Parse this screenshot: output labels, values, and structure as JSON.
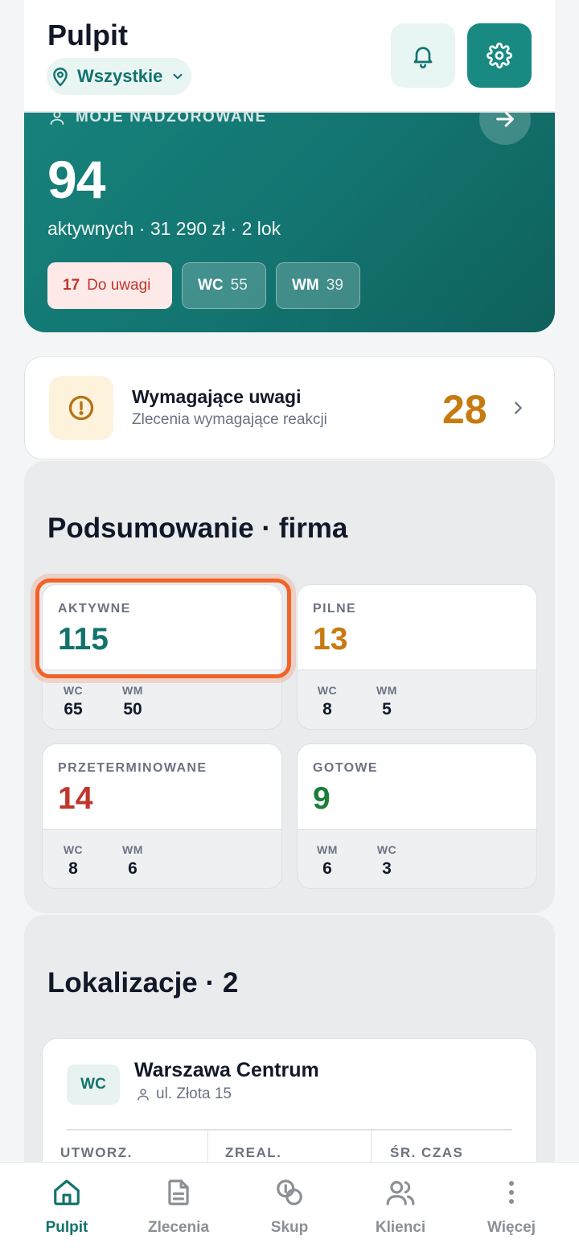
{
  "colors": {
    "accent": "#198a82",
    "accent_dark": "#12736d",
    "warning": "#c77a0f",
    "danger": "#c0362c",
    "success": "#1b7f3a",
    "highlight": "#f26227"
  },
  "header": {
    "title": "Pulpit",
    "location_select": {
      "value": "Wszystkie",
      "icon": "map-pin-icon"
    },
    "notifications_icon": "bell-icon",
    "settings_icon": "gear-icon"
  },
  "supervised": {
    "label": "MOJE NADZOROWANE",
    "count": "94",
    "subtitle": "aktywnych · 31 290 zł · 2 lok",
    "chips": {
      "attention": {
        "count": "17",
        "label": "Do uwagi"
      },
      "wc": {
        "code": "WC",
        "count": "55"
      },
      "wm": {
        "code": "WM",
        "count": "39"
      }
    }
  },
  "attention": {
    "title": "Wymagające uwagi",
    "subtitle": "Zlecenia wymagające reakcji",
    "count": "28"
  },
  "summary": {
    "title": "Podsumowanie · firma",
    "cards": [
      {
        "label": "AKTYWNE",
        "value": "115",
        "color": "#12736d",
        "subs": [
          {
            "k": "WC",
            "v": "65"
          },
          {
            "k": "WM",
            "v": "50"
          }
        ]
      },
      {
        "label": "PILNE",
        "value": "13",
        "color": "#c77a0f",
        "subs": [
          {
            "k": "WC",
            "v": "8"
          },
          {
            "k": "WM",
            "v": "5"
          }
        ]
      },
      {
        "label": "PRZETERMINOWANE",
        "value": "14",
        "color": "#c0362c",
        "subs": [
          {
            "k": "WC",
            "v": "8"
          },
          {
            "k": "WM",
            "v": "6"
          }
        ]
      },
      {
        "label": "GOTOWE",
        "value": "9",
        "color": "#1b7f3a",
        "subs": [
          {
            "k": "WM",
            "v": "6"
          },
          {
            "k": "WC",
            "v": "3"
          }
        ]
      }
    ]
  },
  "locations": {
    "title": "Lokalizacje · 2",
    "items": [
      {
        "code": "WC",
        "name": "Warszawa Centrum",
        "address": "ul. Złota 15",
        "columns": [
          "UTWORZ.",
          "ZREAL.",
          "ŚR. CZAS"
        ]
      }
    ]
  },
  "nav": {
    "items": [
      {
        "label": "Pulpit",
        "icon": "home-icon",
        "active": true
      },
      {
        "label": "Zlecenia",
        "icon": "document-icon",
        "active": false
      },
      {
        "label": "Skup",
        "icon": "coins-icon",
        "active": false
      },
      {
        "label": "Klienci",
        "icon": "users-icon",
        "active": false
      },
      {
        "label": "Więcej",
        "icon": "more-vertical-icon",
        "active": false
      }
    ]
  }
}
